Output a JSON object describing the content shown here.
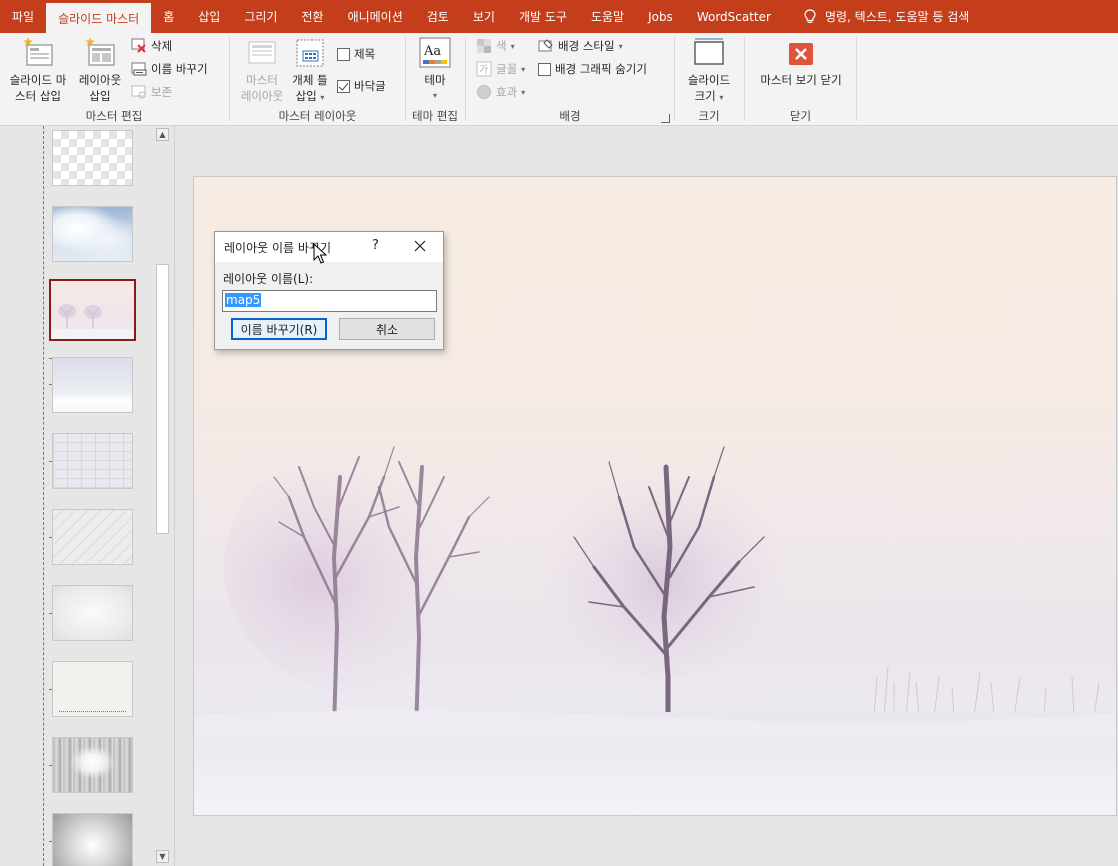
{
  "tabs": [
    {
      "label": "파일",
      "active": false
    },
    {
      "label": "슬라이드 마스터",
      "active": true
    },
    {
      "label": "홈",
      "active": false
    },
    {
      "label": "삽입",
      "active": false
    },
    {
      "label": "그리기",
      "active": false
    },
    {
      "label": "전환",
      "active": false
    },
    {
      "label": "애니메이션",
      "active": false
    },
    {
      "label": "검토",
      "active": false
    },
    {
      "label": "보기",
      "active": false
    },
    {
      "label": "개발 도구",
      "active": false
    },
    {
      "label": "도움말",
      "active": false
    },
    {
      "label": "Jobs",
      "active": false
    },
    {
      "label": "WordScatter",
      "active": false
    }
  ],
  "search": {
    "text": "명령, 텍스트, 도움말 등 검색",
    "icon": "lightbulb-icon"
  },
  "ribbon": {
    "master_edit": {
      "label": "마스터 편집",
      "insert_slide_master_l1": "슬라이드 마",
      "insert_slide_master_l2": "스터 삽입",
      "insert_layout_l1": "레이아웃",
      "insert_layout_l2": "삽입",
      "delete": "삭제",
      "rename": "이름 바꾸기",
      "preserve": "보존"
    },
    "master_layout": {
      "label": "마스터 레이아웃",
      "master_layout_l1": "마스터",
      "master_layout_l2": "레이아웃",
      "insert_placeholder_l1": "개체 틀",
      "insert_placeholder_l2": "삽입",
      "title": "제목",
      "title_checked": false,
      "footer": "바닥글",
      "footer_checked": true
    },
    "edit_theme": {
      "label": "테마 편집",
      "theme": "테마",
      "theme_icon_text": "Aa"
    },
    "background": {
      "label": "배경",
      "colors": "색",
      "fonts": "글꼴",
      "effects": "효과",
      "background_styles": "배경 스타일",
      "hide_background_graphics": "배경 그래픽 숨기기",
      "hide_checked": false
    },
    "size": {
      "label": "크기",
      "slide_size_l1": "슬라이드",
      "slide_size_l2": "크기"
    },
    "close": {
      "label": "닫기",
      "close_master_view": "마스터 보기 닫기"
    }
  },
  "dialog": {
    "title": "레이아웃 이름 바꾸기",
    "help": "?",
    "field_label": "레이아웃 이름(L):",
    "field_value": "map5",
    "rename_button": "이름 바꾸기(R)",
    "cancel_button": "취소"
  },
  "colors": {
    "accent": "#c43e1c",
    "selected_thumb_border": "#8b1a1a",
    "selection_highlight": "#3399ff"
  }
}
